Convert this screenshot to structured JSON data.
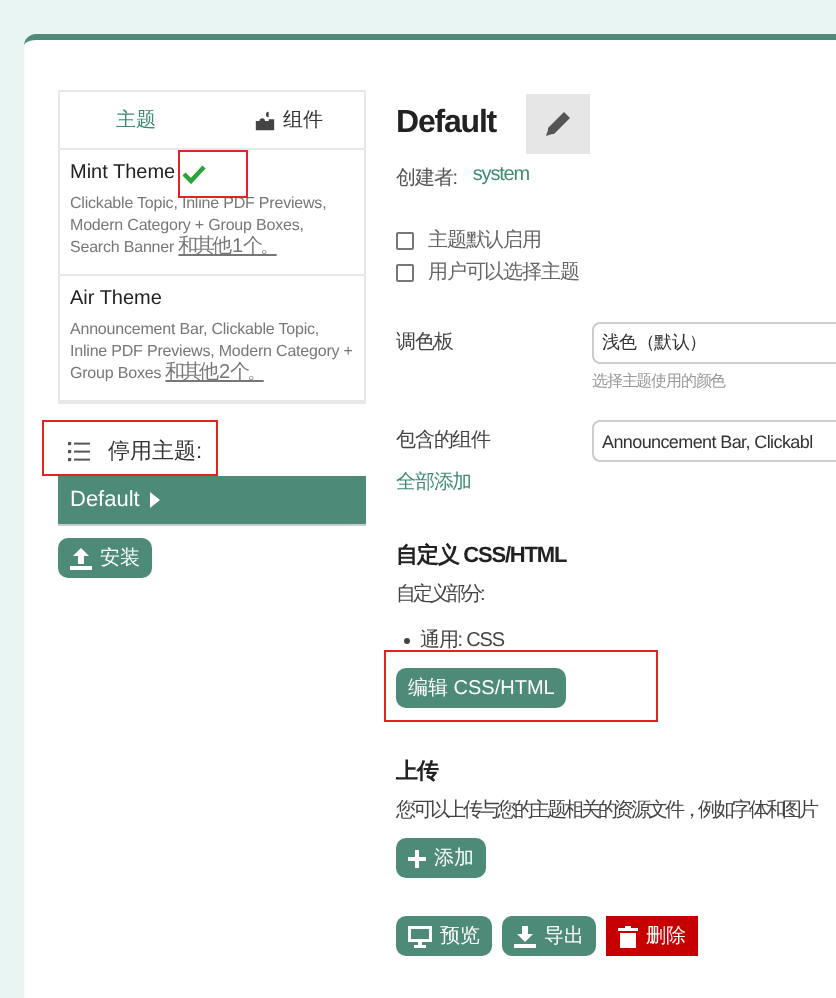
{
  "sidebar": {
    "tabs": [
      {
        "label": "主题",
        "kind": "text",
        "selected": true
      },
      {
        "label": "组件",
        "kind": "puzzle",
        "selected": false
      }
    ],
    "themes": [
      {
        "name": "Mint Theme",
        "active": true,
        "highlighted": true,
        "components": "Clickable Topic, Inline PDF Previews, Modern Category + Group Boxes, Search Banner",
        "more": "和其他 1 个。"
      },
      {
        "name": "Air Theme",
        "active": false,
        "highlighted": false,
        "components": "Announcement Bar, Clickable Topic, Inline PDF Previews, Modern Category + Group Boxes",
        "more": "和其他 2 个。"
      }
    ],
    "inactive_heading": {
      "label": "停用主题:",
      "highlighted": true
    },
    "inactive_themes": [
      {
        "name": "Default",
        "selected": true
      }
    ],
    "install_button": "安装"
  },
  "detail": {
    "title": "Default",
    "created_by_label": "创建者:",
    "created_by": "system",
    "checkboxes": [
      {
        "label": "主题默认启用",
        "checked": false
      },
      {
        "label": "用户可以选择主题",
        "checked": false
      }
    ],
    "palette": {
      "label": "调色板",
      "value": "浅色（默认）",
      "hint": "选择主题使用的颜色"
    },
    "components": {
      "label": "包含的组件",
      "value": "Announcement Bar, Clickabl",
      "add_all": "全部添加"
    },
    "custom": {
      "heading": "自定义 CSS/HTML",
      "subheading": "自定义部分:",
      "items": [
        "通用: CSS"
      ],
      "edit_button": "编辑 CSS/HTML",
      "highlighted": true
    },
    "upload": {
      "heading": "上传",
      "description": "您可以上传与您的主题相关的资源文件，例如字体和图片",
      "add_button": "添加"
    },
    "actions": [
      {
        "label": "预览",
        "kind": "preview"
      },
      {
        "label": "导出",
        "kind": "export"
      },
      {
        "label": "删除",
        "kind": "delete"
      }
    ]
  }
}
